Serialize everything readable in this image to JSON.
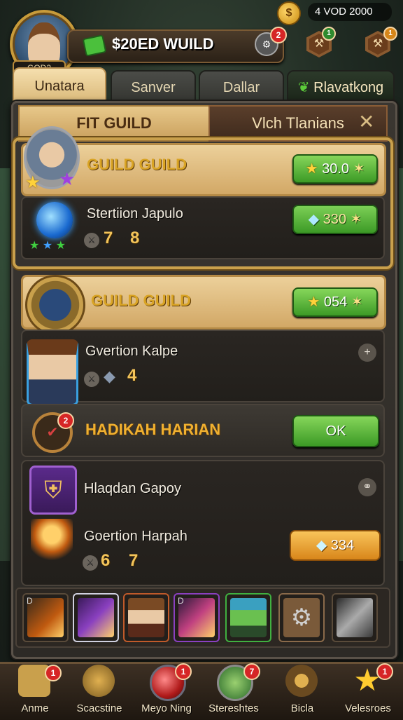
{
  "header": {
    "avatar_tag": "GOD2",
    "guild_title": "$20ED WUILD",
    "timer_badge": "2",
    "resource_text": "4  VOD   2000",
    "coin_label": "$",
    "hex_badge_1": "1",
    "hex_badge_2": "1"
  },
  "tabs": [
    {
      "label": "Unatara"
    },
    {
      "label": "Sanver"
    },
    {
      "label": "Dallar"
    },
    {
      "label": "Rlavatkong"
    }
  ],
  "subheader": {
    "left": "FIT GUILD",
    "right": "Vlch Tlanians"
  },
  "cards": {
    "guild1": {
      "name": "GUILD GUILD",
      "reward": "30.0"
    },
    "item1": {
      "name": "Stertiion Japulo",
      "stat_a": "7",
      "stat_b": "8",
      "value": "330"
    },
    "guild2": {
      "name": "GUILD GUILD",
      "reward": "054"
    },
    "item2": {
      "name": "Gvertion Kalpe",
      "stat_b": "4"
    },
    "quest": {
      "name": "HADIKAH HARIAN",
      "badge": "2",
      "button": "OK"
    },
    "item3": {
      "name": "Hlaqdan Gapoy"
    },
    "item4": {
      "name": "Goertion Harpah",
      "stat_a": "6",
      "stat_b": "7",
      "value": "334"
    }
  },
  "slots": [
    "D",
    "",
    "",
    "D",
    "",
    "",
    ""
  ],
  "bottom_nav": [
    {
      "label": "Anme",
      "badge": "1"
    },
    {
      "label": "Scacstine",
      "badge": ""
    },
    {
      "label": "Meyo Ning",
      "badge": "1"
    },
    {
      "label": "Stereshtes",
      "badge": "7"
    },
    {
      "label": "Bicla",
      "badge": ""
    },
    {
      "label": "Velesroes",
      "badge": "1"
    }
  ],
  "colors": {
    "accent_gold": "#d9a425",
    "button_green": "#3c9a26",
    "button_orange": "#d8861a",
    "badge_red": "#d62626"
  }
}
